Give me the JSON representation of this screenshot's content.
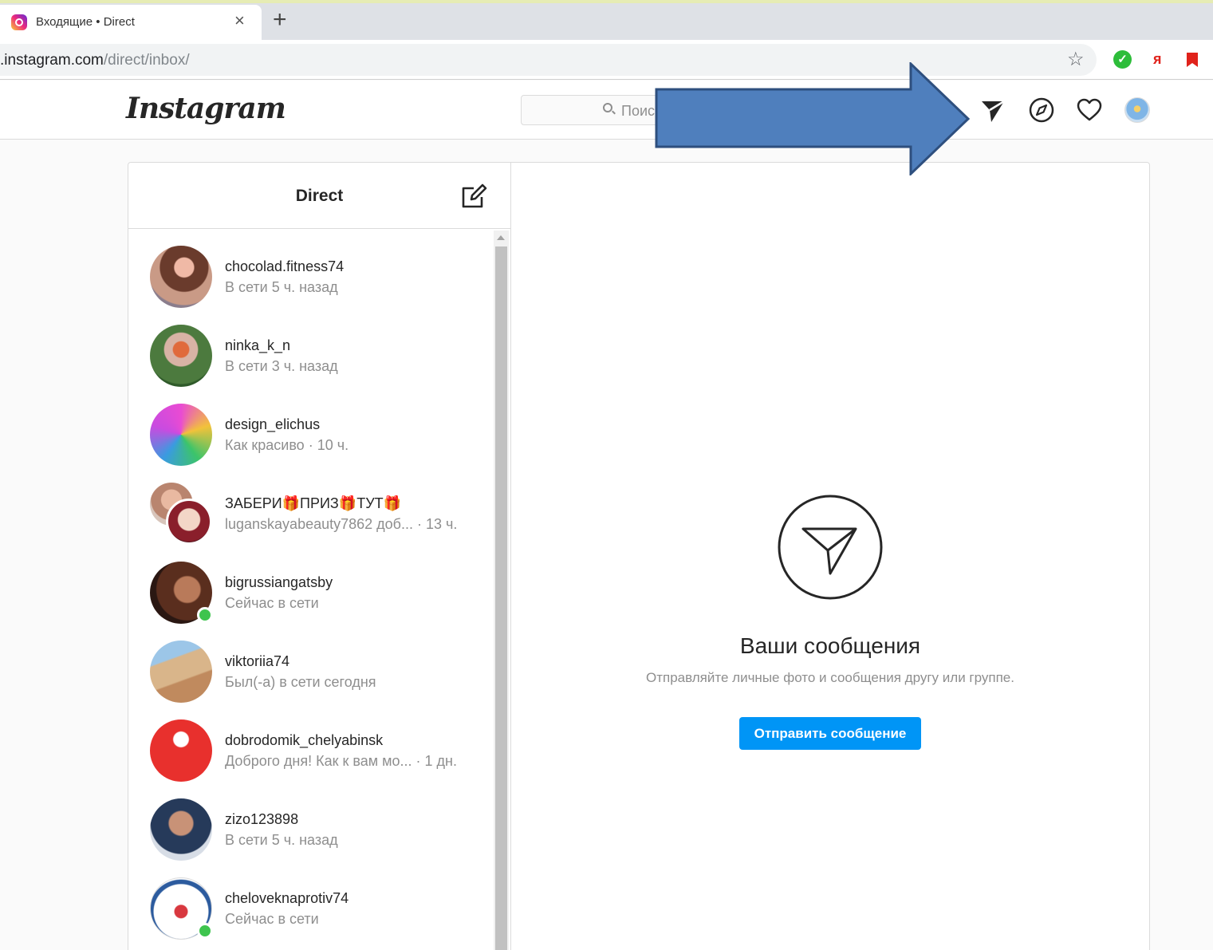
{
  "browser": {
    "tab_title": "Входящие • Direct",
    "tab_close": "×",
    "new_tab": "+",
    "url_host": ".instagram.com",
    "url_path": "/direct/inbox/",
    "star": "☆",
    "ext_check": "✓",
    "ext_ya": "я"
  },
  "header": {
    "logo": "Instagram",
    "search_placeholder": "Поис"
  },
  "direct": {
    "title": "Direct",
    "conversations": [
      {
        "name": "chocolad.fitness74",
        "status": "В сети 5 ч. назад",
        "online": false
      },
      {
        "name": "ninka_k_n",
        "status": "В сети 3 ч. назад",
        "online": false
      },
      {
        "name": "design_elichus",
        "status": "Как красиво · 10 ч.",
        "online": false
      },
      {
        "name": "ЗАБЕРИ🎁ПРИЗ🎁ТУТ🎁",
        "status": "luganskayabeauty7862 доб... · 13 ч.",
        "online": false
      },
      {
        "name": "bigrussiangatsby",
        "status": "Сейчас в сети",
        "online": true
      },
      {
        "name": "viktoriia74",
        "status": "Был(-а) в сети сегодня",
        "online": false
      },
      {
        "name": "dobrodomik_chelyabinsk",
        "status": "Доброго дня! Как к вам мо... · 1 дн.",
        "online": false
      },
      {
        "name": "zizo123898",
        "status": "В сети 5 ч. назад",
        "online": false
      },
      {
        "name": "cheloveknaprotiv74",
        "status": "Сейчас в сети",
        "online": true
      }
    ]
  },
  "empty_state": {
    "title": "Ваши сообщения",
    "subtitle": "Отправляйте личные фото и сообщения другу или группе.",
    "button": "Отправить сообщение"
  },
  "colors": {
    "accent_button": "#0095f6",
    "online_dot": "#3ec44e",
    "annotation_arrow": "#4f7fbd"
  }
}
